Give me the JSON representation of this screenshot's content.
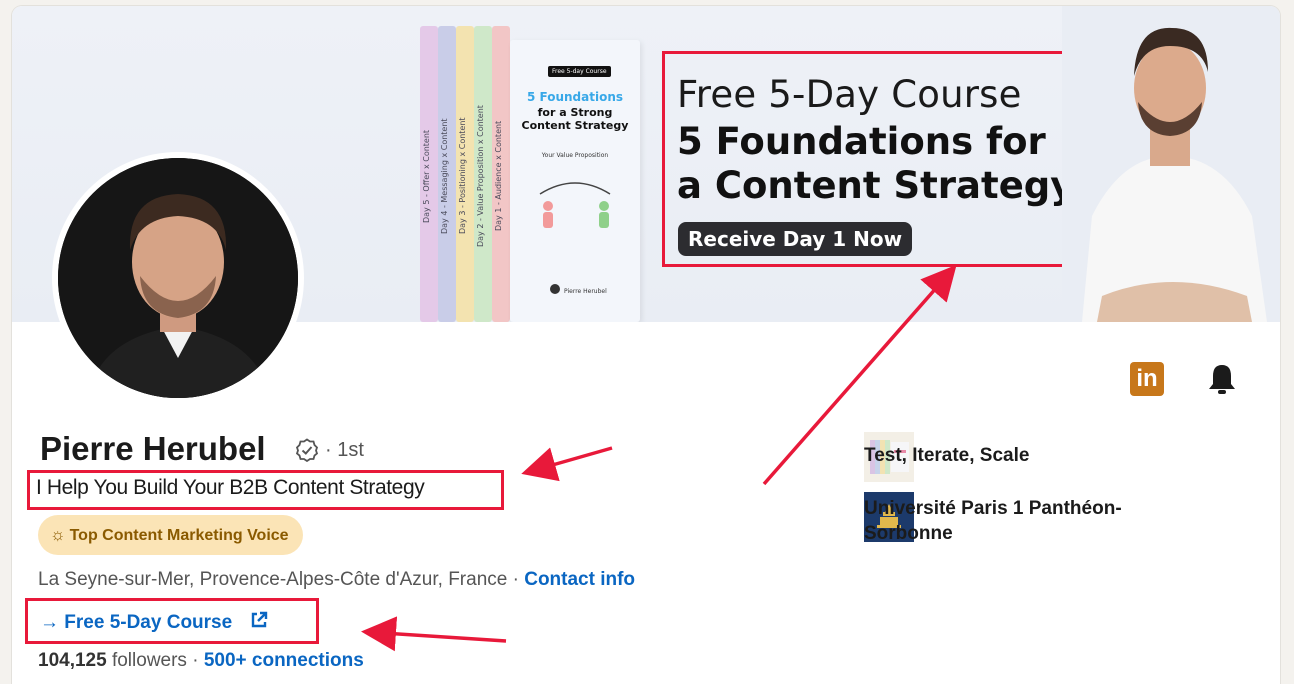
{
  "banner": {
    "line1": "Free 5-Day Course",
    "line2a": "5 Foundations for",
    "line2b": "a Content Strategy",
    "cta": "Receive Day 1 Now",
    "book": {
      "tag": "Free 5-day Course",
      "title1": "5 Foundations",
      "title2a": "for a Strong",
      "title2b": "Content Strategy",
      "subtitle": "Your Value Proposition",
      "author": "Pierre Herubel",
      "spines": [
        "Day 5 - Offer x Content",
        "Day 4 - Messaging x Content",
        "Day 3 - Positioning x Content",
        "Day 2 - Value Proposition x Content",
        "Day 1 - Audience x Content"
      ],
      "spine_colors": [
        "#e4c9e8",
        "#c9cde8",
        "#f3e3b0",
        "#cfe8c9",
        "#f2c6c6"
      ]
    }
  },
  "profile": {
    "name": "Pierre Herubel",
    "degree": "· 1st",
    "headline": "I Help You Build Your B2B Content Strategy",
    "badge": "Top Content Marketing Voice",
    "location": "La Seyne-sur-Mer, Provence-Alpes-Côte d'Azur, France · ",
    "contact_info": "Contact info",
    "external_link": "→ Free 5-Day Course",
    "followers_count": "104,125",
    "followers_label": " followers",
    "separator": " · ",
    "connections": "500+ connections"
  },
  "sidebar": {
    "items": [
      {
        "label": "Test, Iterate, Scale",
        "icon": "company-logo-icon"
      },
      {
        "label1": "Université Paris 1 Panthéon-",
        "label2": "Sorbonne",
        "icon": "university-logo-icon"
      }
    ]
  },
  "icons": {
    "linkedin": "in",
    "bell": "bell-icon"
  },
  "colors": {
    "accent_blue": "#0a66c2",
    "highlight_red": "#e8193a",
    "badge_bg": "#fbe4b6"
  }
}
